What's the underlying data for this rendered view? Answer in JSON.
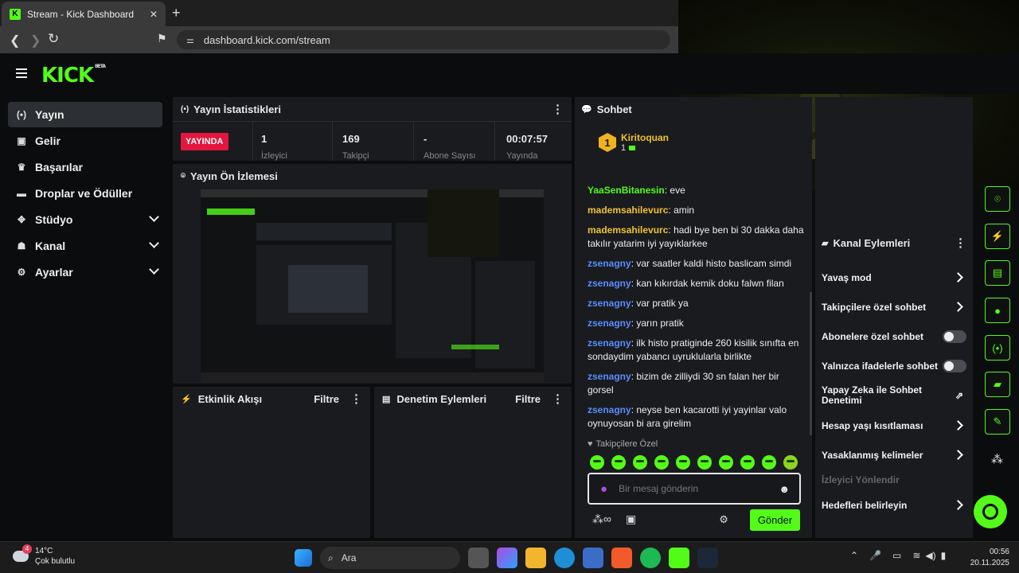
{
  "browser": {
    "tab_title": "Stream - Kick Dashboard",
    "tab_close": "✕",
    "new_tab": "+",
    "url": "dashboard.kick.com/stream"
  },
  "brand": {
    "logo": "KICK",
    "beta": "BETA",
    "accent": "#53fc18"
  },
  "sidebar": {
    "items": [
      {
        "label": "Yayın",
        "icon": "broadcast-icon",
        "glyph": "(•)"
      },
      {
        "label": "Gelir",
        "icon": "revenue-icon",
        "glyph": "▣"
      },
      {
        "label": "Başarılar",
        "icon": "trophy-icon",
        "glyph": "♛"
      },
      {
        "label": "Droplar ve Ödüller",
        "icon": "drops-icon",
        "glyph": "▬"
      },
      {
        "label": "Stüdyo",
        "icon": "studio-icon",
        "glyph": "✥"
      },
      {
        "label": "Kanal",
        "icon": "channel-icon",
        "glyph": "☗"
      },
      {
        "label": "Ayarlar",
        "icon": "settings-icon",
        "glyph": "⚙"
      }
    ]
  },
  "stats": {
    "title": "Yayın İstatistikleri",
    "live_badge": "YAYINDA",
    "viewers_value": "1",
    "viewers_label": "İzleyici",
    "followers_value": "169",
    "followers_label": "Takipçi",
    "subs_value": "-",
    "subs_label": "Abone Sayısı",
    "uptime_value": "00:07:57",
    "uptime_label": "Yayında"
  },
  "preview": {
    "title": "Yayın Ön İzlemesi"
  },
  "activity": {
    "title": "Etkinlik Akışı",
    "filter": "Filtre"
  },
  "moderation": {
    "title": "Denetim Eylemleri",
    "filter": "Filtre"
  },
  "chat": {
    "title": "Sohbet",
    "pinned_user": "Kiritoquan",
    "pinned_rank": "1",
    "pinned_count": "1",
    "messages": [
      {
        "user": "YaaSenBitanesin",
        "text": "eve"
      },
      {
        "user": "mademsahilevurc",
        "text": "amin"
      },
      {
        "user": "mademsahilevurc",
        "text": "hadi bye ben bi 30 dakka daha takılır yatarim iyi yayıklarkee"
      },
      {
        "user": "zsenagny",
        "text": "var saatler kaldi histo baslicam simdi"
      },
      {
        "user": "zsenagny",
        "text": "kan kıkırdak kemik doku falwn filan"
      },
      {
        "user": "zsenagny",
        "text": "var pratik ya"
      },
      {
        "user": "zsenagny",
        "text": "yarın pratik"
      },
      {
        "user": "zsenagny",
        "text": "ilk histo pratiginde 260 kisilik sınıfta en sondaydim yabancı uyruklularla birlikte"
      },
      {
        "user": "zsenagny",
        "text": "bizim de zilliydi 30 sn falan her bir gorsel"
      },
      {
        "user": "zsenagny",
        "text": "neyse ben kacarotti iyi yayinlar valo oynuyosan bi ara girelim"
      }
    ],
    "followers_only": "Takipçilere Özel",
    "input_placeholder": "Bir mesaj gönderin",
    "send": "Gönder"
  },
  "actions": {
    "title": "Kanal Eylemleri",
    "items": [
      {
        "label": "Yavaş mod",
        "control": "arrow"
      },
      {
        "label": "Takipçilere özel sohbet",
        "control": "arrow"
      },
      {
        "label": "Abonelere özel sohbet",
        "control": "toggle"
      },
      {
        "label": "Yalnızca ifadelerle sohbet",
        "control": "toggle"
      },
      {
        "label": "Yapay Zeka ile Sohbet Denetimi",
        "control": "external"
      },
      {
        "label": "Hesap yaşı kısıtlaması",
        "control": "arrow"
      },
      {
        "label": "Yasaklanmış kelimeler",
        "control": "arrow"
      }
    ],
    "section": "İzleyici Yönlendir",
    "goals": "Hedefleri belirleyin"
  },
  "taskbar": {
    "weather_temp": "14°C",
    "weather_desc": "Çok bulutlu",
    "weather_badge": "4",
    "search": "Ara",
    "time": "00:56",
    "date": "20.11.2025"
  }
}
